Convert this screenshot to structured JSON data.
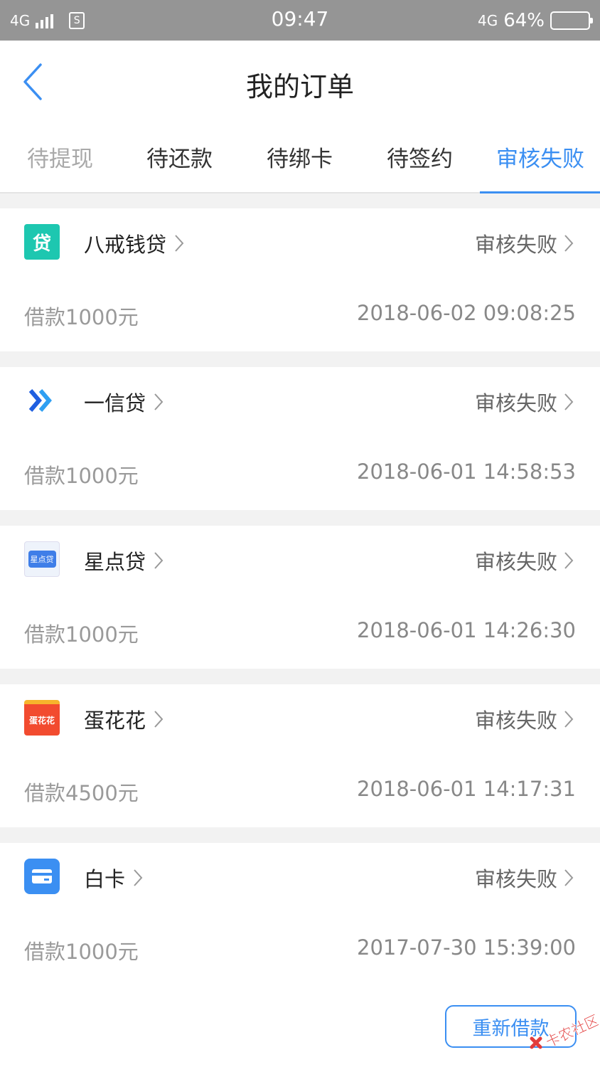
{
  "status_bar": {
    "network_left": "4G",
    "sim_label": "S",
    "time": "09:47",
    "network_right": "4G",
    "battery_percent": "64%"
  },
  "nav": {
    "title": "我的订单",
    "back_icon": "chevron-left-icon"
  },
  "tabs": [
    {
      "label": "待提现"
    },
    {
      "label": "待还款"
    },
    {
      "label": "待绑卡"
    },
    {
      "label": "待签约"
    },
    {
      "label": "审核失败"
    }
  ],
  "active_tab": "审核失败",
  "orders": [
    {
      "name": "八戒钱贷",
      "status": "审核失败",
      "amount": "借款1000元",
      "time": "2018-06-02 09:08:25",
      "logo_text": "贷",
      "logo_color": "#1dc7b0"
    },
    {
      "name": "一信贷",
      "status": "审核失败",
      "amount": "借款1000元",
      "time": "2018-06-01 14:58:53",
      "logo_text": "",
      "logo_color": "#1f5fe0"
    },
    {
      "name": "星点贷",
      "status": "审核失败",
      "amount": "借款1000元",
      "time": "2018-06-01 14:26:30",
      "logo_text": "星点贷",
      "logo_color": "#3f7ee8"
    },
    {
      "name": "蛋花花",
      "status": "审核失败",
      "amount": "借款4500元",
      "time": "2018-06-01 14:17:31",
      "logo_text": "蛋花花",
      "logo_color": "#f24b2f"
    },
    {
      "name": "白卡",
      "status": "审核失败",
      "amount": "借款1000元",
      "time": "2017-07-30 15:39:00",
      "logo_text": "",
      "logo_color": "#3b8ff2"
    }
  ],
  "action_button": "重新借款",
  "watermark_text": "卡农社区",
  "colors": {
    "accent": "#3b8ff2",
    "status_bar": "#959595"
  }
}
